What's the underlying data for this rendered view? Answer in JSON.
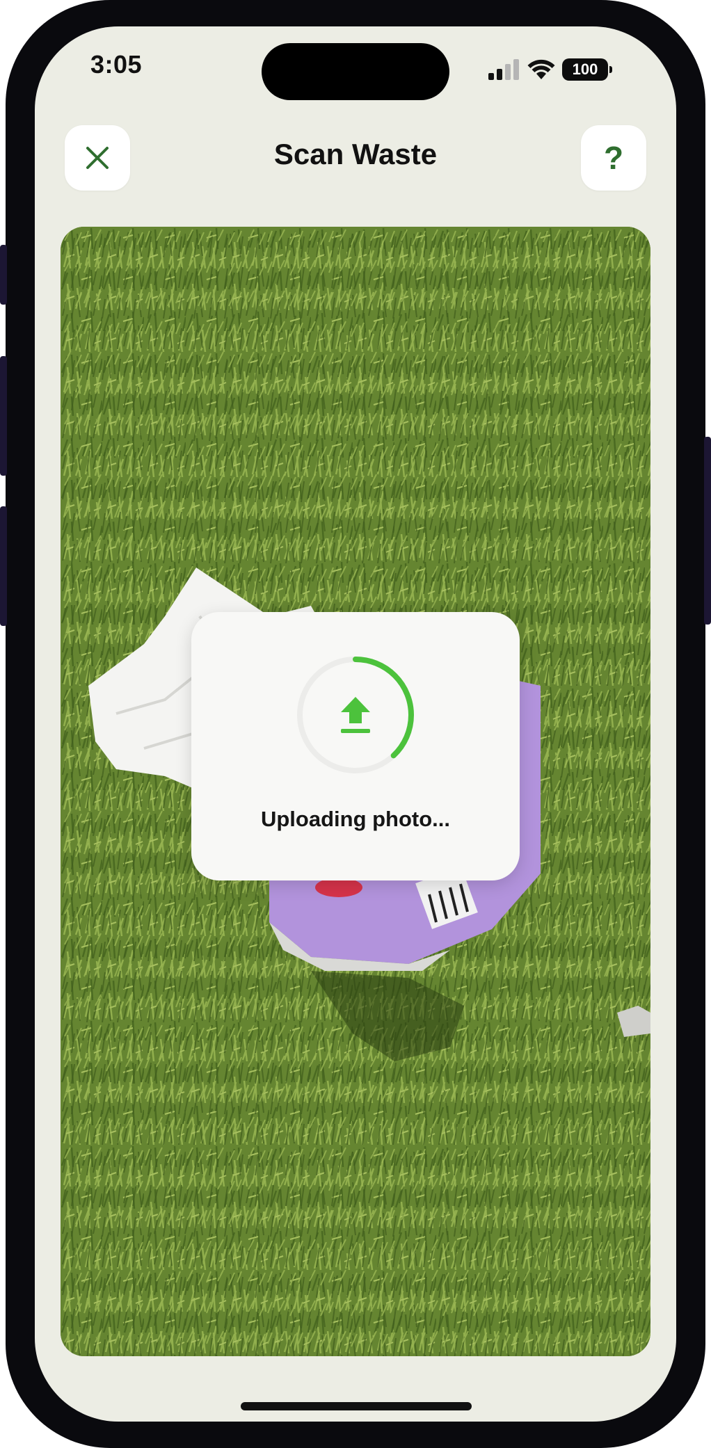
{
  "status_bar": {
    "time": "3:05",
    "battery": "100",
    "signal_icon": "cellular-signal-icon",
    "wifi_icon": "wifi-icon"
  },
  "header": {
    "title": "Scan Waste",
    "close_icon": "close-icon",
    "help_label": "?"
  },
  "upload": {
    "label": "Uploading photo...",
    "progress": 0.38,
    "icon": "upload-arrow-icon"
  },
  "colors": {
    "accent_green": "#4cc23c",
    "icon_green": "#2f6e2f",
    "screen_bg": "#ecede4"
  }
}
